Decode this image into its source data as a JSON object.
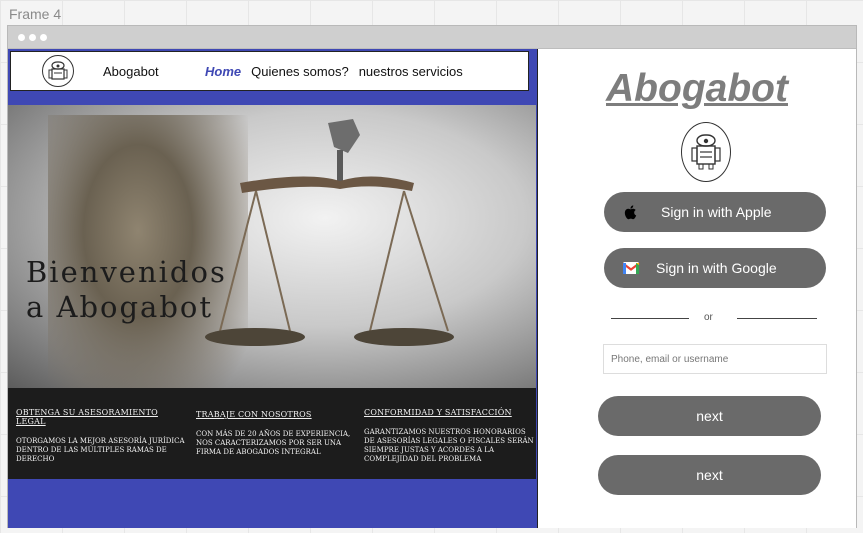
{
  "frame": {
    "label": "Frame 4"
  },
  "site": {
    "nav": {
      "brand": "Abogabot",
      "links": [
        "Home",
        "Quienes somos?",
        "nuestros servicios"
      ]
    },
    "hero": {
      "line1": "Bienvenidos",
      "line2": "a Abogabot"
    },
    "features": [
      {
        "title": "Obtenga su asesoramiento legal",
        "text": "Otorgamos la mejor asesoría jurídica dentro de las múltiples ramas de derecho"
      },
      {
        "title": "Trabaje con nosotros",
        "text": "Con más de 20 años de experiencia, nos caracterizamos por ser una firma de abogados integral"
      },
      {
        "title": "Conformidad y satisfacción",
        "text": "Garantizamos nuestros honorarios de asesorías legales o fiscales serán siempre justas y acordes a la complejidad del problema"
      }
    ]
  },
  "login": {
    "title": "Abogabot",
    "apple_label": "Sign in with Apple",
    "google_label": "Sign in with Google",
    "or_label": "or",
    "input_placeholder": "Phone, email or username",
    "next_label_1": "next",
    "next_label_2": "next"
  },
  "colors": {
    "accent": "#3f48b4",
    "button": "#6a6a6a",
    "dark_band": "#1c1c1c",
    "title_gray": "#7d7d7d"
  },
  "icons": [
    "robot-logo-icon",
    "apple-icon",
    "gmail-icon"
  ]
}
